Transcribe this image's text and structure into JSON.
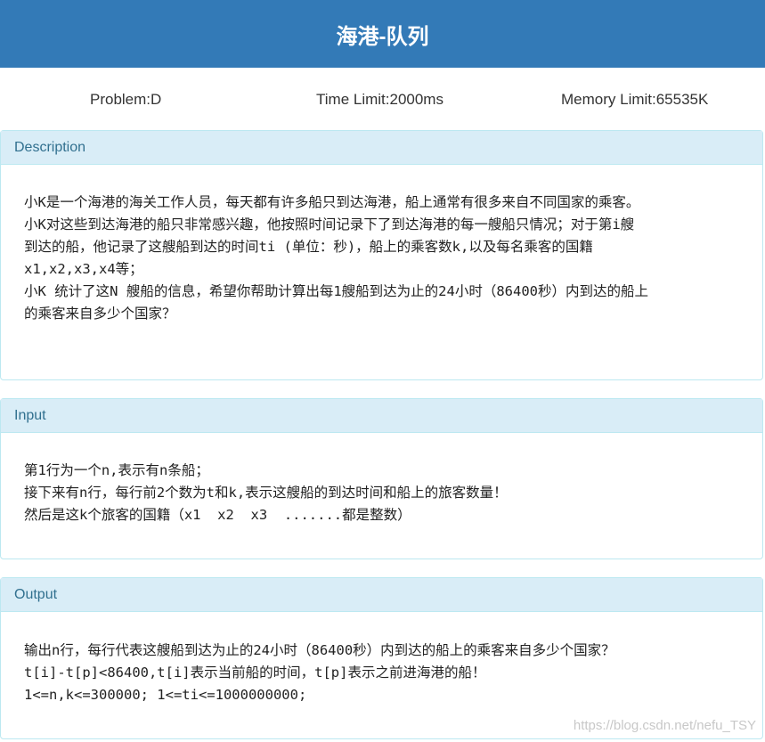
{
  "header": {
    "title": "海港-队列"
  },
  "limits": {
    "problem": "Problem:D",
    "time": "Time Limit:2000ms",
    "memory": "Memory Limit:65535K"
  },
  "sections": {
    "description": {
      "heading": "Description",
      "lines": [
        "小K是一个海港的海关工作人员，每天都有许多船只到达海港，船上通常有很多来自不同国家的乘客。",
        "小K对这些到达海港的船只非常感兴趣，他按照时间记录下了到达海港的每一艘船只情况；对于第i艘",
        "到达的船，他记录了这艘船到达的时间ti (单位：秒)，船上的乘客数k,以及每名乘客的国籍",
        "x1,x2,x3,x4等；",
        "小K 统计了这N 艘船的信息，希望你帮助计算出每1艘船到达为止的24小时（86400秒）内到达的船上",
        "的乘客来自多少个国家？"
      ]
    },
    "input": {
      "heading": "Input",
      "lines": [
        "第1行为一个n,表示有n条船；",
        "接下来有n行，每行前2个数为t和k,表示这艘船的到达时间和船上的旅客数量！",
        "然后是这k个旅客的国籍（x1  x2  x3  .......都是整数）"
      ]
    },
    "output": {
      "heading": "Output",
      "lines": [
        "输出n行，每行代表这艘船到达为止的24小时（86400秒）内到达的船上的乘客来自多少个国家？",
        "t[i]-t[p]<86400,t[i]表示当前船的时间，t[p]表示之前进海港的船！",
        "1<=n,k<=300000; 1<=ti<=1000000000;"
      ]
    }
  },
  "watermark": "https://blog.csdn.net/nefu_TSY",
  "colors": {
    "header_bg": "#337ab7",
    "panel_heading_bg": "#d9edf7",
    "panel_border": "#bce8f1",
    "panel_heading_text": "#31708f"
  }
}
